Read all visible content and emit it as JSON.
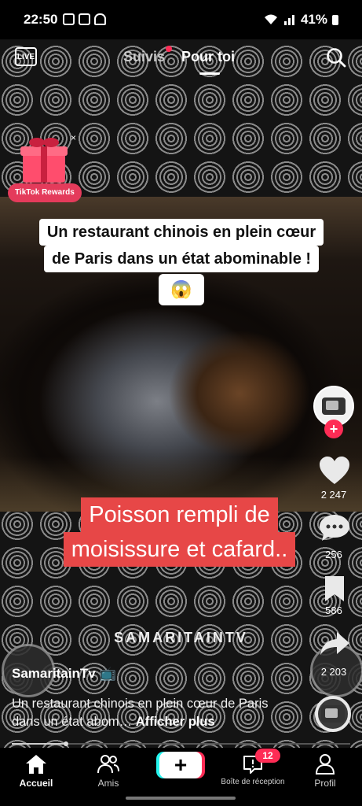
{
  "status_bar": {
    "time": "22:50",
    "battery": "41%"
  },
  "top_nav": {
    "live_label": "LIVE",
    "tabs": [
      {
        "label": "Suivis"
      },
      {
        "label": "Pour toi"
      }
    ]
  },
  "rewards": {
    "label": "TikTok Rewards",
    "close": "×"
  },
  "video": {
    "caption_lines": [
      "Un restaurant chinois en plein cœur",
      "de Paris dans un état abominable !"
    ],
    "caption_emoji": "😱",
    "overlay_lines": [
      "Poisson rempli de",
      "moisissure et cafard.."
    ],
    "watermark": "SAMARITAINTV"
  },
  "actions": {
    "likes": "2 247",
    "comments": "256",
    "saves": "586",
    "shares": "2 203"
  },
  "post": {
    "username": "SamaritainTv 📺",
    "description": "Un restaurant chinois en plein cœur de Paris dans un état abom…",
    "more_label": "Afficher plus",
    "progress": 0.16
  },
  "bottom_nav": {
    "items": [
      {
        "label": "Accueil"
      },
      {
        "label": "Amis"
      },
      {
        "label": "Boîte de réception",
        "badge": "12"
      },
      {
        "label": "Profil"
      }
    ],
    "create": "+"
  }
}
